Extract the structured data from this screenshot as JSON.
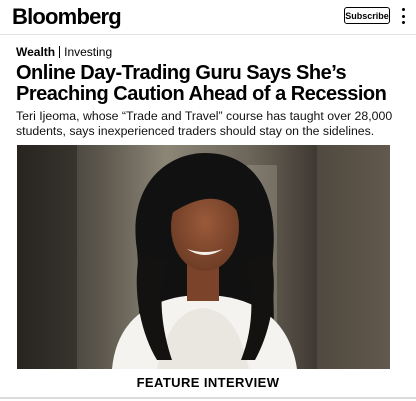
{
  "header": {
    "logo": "Bloomberg",
    "subscribe_label": "Subscribe"
  },
  "article": {
    "section": "Wealth",
    "subsection": "Investing",
    "headline": "Online Day-Trading Guru Says She’s Preaching Caution Ahead of a Recession",
    "dek": "Teri Ijeoma, whose “Trade and Travel” course has taught over 28,000 students, says inexperienced traders should stay on the sidelines.",
    "photo_caption": "FEATURE INTERVIEW"
  },
  "icons": {
    "menu": "vertical-ellipsis-icon"
  }
}
